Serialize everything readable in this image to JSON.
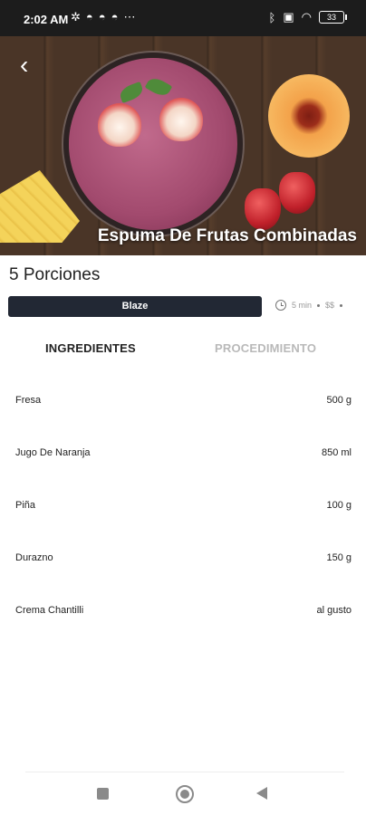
{
  "status_bar": {
    "time": "2:02 AM",
    "battery": "33",
    "left_icons": [
      "fan-icon",
      "discord-icon",
      "discord-icon",
      "discord-icon",
      "more-dots-icon"
    ],
    "right_icons": [
      "bluetooth-icon",
      "nfc-icon",
      "wifi-icon",
      "battery-icon"
    ]
  },
  "hero": {
    "title": "Espuma De Frutas Combinadas"
  },
  "recipe": {
    "servings": "5 Porciones",
    "tag": "Blaze",
    "time": "5 min",
    "price": "$$"
  },
  "tabs": [
    {
      "label": "INGREDIENTES",
      "active": true
    },
    {
      "label": "PROCEDIMIENTO",
      "active": false
    }
  ],
  "ingredients": [
    {
      "name": "Fresa",
      "qty": "500 g"
    },
    {
      "name": "Jugo De Naranja",
      "qty": "850 ml"
    },
    {
      "name": "Piña",
      "qty": "100 g"
    },
    {
      "name": "Durazno",
      "qty": "150 g"
    },
    {
      "name": "Crema Chantilli",
      "qty": "al gusto"
    }
  ],
  "colors": {
    "status_bar": "#1c1c1c",
    "tag_button": "#222834",
    "inactive_tab": "#b9b9b9"
  }
}
